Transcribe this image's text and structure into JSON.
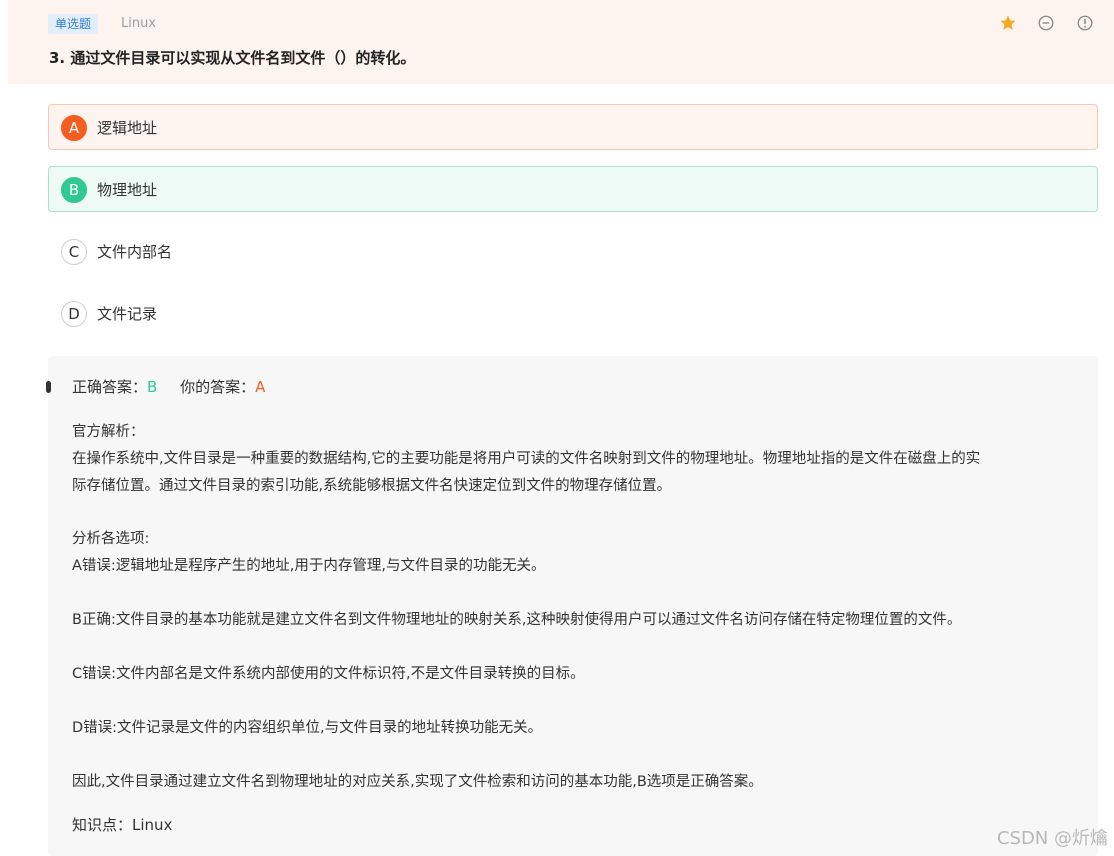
{
  "header": {
    "question_type": "单选题",
    "subject": "Linux",
    "question": "3. 通过文件目录可以实现从文件名到文件（）的转化。",
    "icons": [
      "star-icon",
      "minus-circle-icon",
      "info-icon"
    ]
  },
  "options": [
    {
      "letter": "A",
      "text": "逻辑地址",
      "state": "wrong"
    },
    {
      "letter": "B",
      "text": "物理地址",
      "state": "correct"
    },
    {
      "letter": "C",
      "text": "文件内部名",
      "state": "normal"
    },
    {
      "letter": "D",
      "text": "文件记录",
      "state": "normal"
    }
  ],
  "analysis": {
    "correct_label": "正确答案：",
    "correct_value": "B",
    "user_label": "你的答案：",
    "user_value": "A",
    "title": "官方解析：",
    "intro_line1": "在操作系统中,文件目录是一种重要的数据结构,它的主要功能是将用户可读的文件名映射到文件的物理地址。物理地址指的是文件在磁盘上的实",
    "intro_line2": "际存储位置。通过文件目录的索引功能,系统能够根据文件名快速定位到文件的物理存储位置。",
    "options_title": "分析各选项:",
    "a_text": "A错误:逻辑地址是程序产生的地址,用于内存管理,与文件目录的功能无关。",
    "b_text": "B正确:文件目录的基本功能就是建立文件名到文件物理地址的映射关系,这种映射使得用户可以通过文件名访问存储在特定物理位置的文件。",
    "c_text": "C错误:文件内部名是文件系统内部使用的文件标识符,不是文件目录转换的目标。",
    "d_text": "D错误:文件记录是文件的内容组织单位,与文件目录的地址转换功能无关。",
    "conclusion": "因此,文件目录通过建立文件名到物理地址的对应关系,实现了文件检索和访问的基本功能,B选项是正确答案。",
    "knowledge_label": "知识点：",
    "knowledge_value": "Linux"
  },
  "watermark": "CSDN @炘爚",
  "colors": {
    "header_bg": "#fdf3ef",
    "wrong": "#f35d22",
    "correct": "#2fc992",
    "tag_bg": "#e3eefb",
    "tag_text": "#2d7fd6",
    "star": "#f5a623"
  }
}
